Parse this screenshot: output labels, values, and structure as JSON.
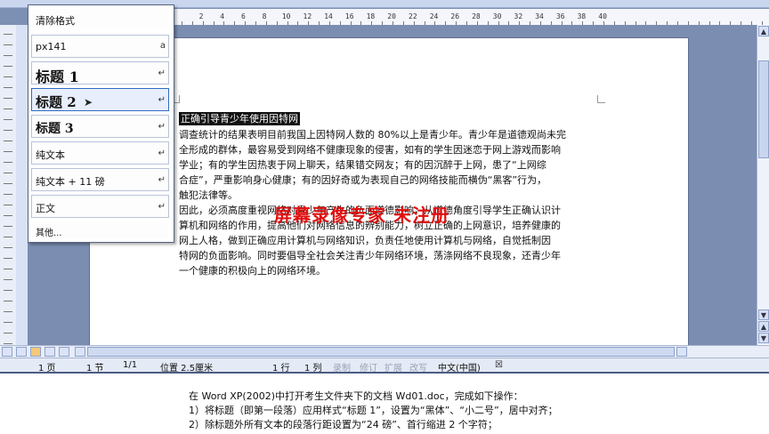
{
  "ruler": {
    "numbers": [
      "2",
      "4",
      "6",
      "8",
      "10",
      "12",
      "14",
      "16",
      "18",
      "20",
      "22",
      "24",
      "26",
      "28",
      "30",
      "32",
      "34",
      "36",
      "38",
      "40"
    ]
  },
  "document": {
    "title": "正确引导青少年使用因特网",
    "lines": [
      "调查统计的结果表明目前我国上因特网人数的 80%以上是青少年。青少年是道德观尚未完",
      "全形成的群体，最容易受到网络不健康现象的侵害，如有的学生因迷恋于网上游戏而影响",
      "学业；有的学生因热衷于网上聊天，结果错交网友；有的因沉醉于上网，患了“上网综",
      "合症”，严重影响身心健康；有的因好奇或为表现自己的网络技能而横伪“黑客”行为，",
      "触犯法律等。",
      "因此，必须高度重视网络对青少年产生的负面道德影响，从道德角度引导学生正确认识计",
      "算机和网络的作用，提高他们对网络信息的辨别能力，树立正确的上网意识，培养健康的",
      "网上人格，做到正确应用计算机与网络知识，负责任地使用计算机与网络，自觉抵制因",
      "特网的负面影响。同时要倡导全社会关注青少年网络环境，荡涤网络不良现象，还青少年",
      "一个健康的积极向上的网络环境。"
    ],
    "watermark": "屏幕录像专家 未注册"
  },
  "style_menu": {
    "items": [
      {
        "label": "清除格式",
        "mark": ""
      },
      {
        "label": "px141",
        "mark": "a"
      },
      {
        "label": "标题 1",
        "mark": "↵"
      },
      {
        "label": "标题 2",
        "mark": "↵"
      },
      {
        "label": "标题 3",
        "mark": "↵"
      },
      {
        "label": "纯文本",
        "mark": "↵"
      },
      {
        "label": "纯文本 + 11 磅",
        "mark": "↵"
      },
      {
        "label": "正文",
        "mark": "↵"
      },
      {
        "label": "其他...",
        "mark": ""
      }
    ]
  },
  "status": {
    "page": "1 页",
    "section": "1 节",
    "pages": "1/1",
    "position": "位置 2.5厘米",
    "line": "1 行",
    "column": "1 列",
    "rec": "录制",
    "trk": "修订",
    "ext": "扩展",
    "ovr": "改写",
    "language": "中文(中国)"
  },
  "instructions": {
    "lines": [
      "在 Word XP(2002)中打开考生文件夹下的文档 Wd01.doc，完成如下操作：",
      "1）将标题（即第一段落）应用样式“标题 1”，设置为“黑体”、“小二号”，居中对齐；",
      "2）除标题外所有文本的段落行距设置为“24 磅”、首行缩进 2 个字符；"
    ]
  },
  "colors": {
    "selection": "#111111",
    "watermark": "#e01010",
    "hover": "#316ac5"
  }
}
